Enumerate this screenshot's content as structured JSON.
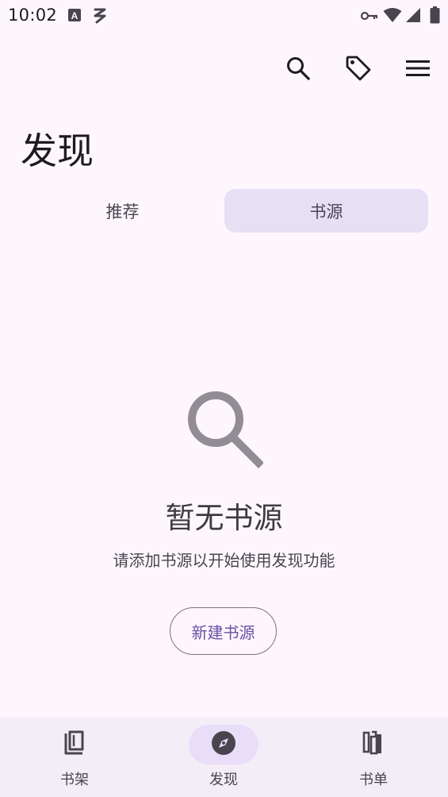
{
  "status_bar": {
    "time": "10:02",
    "icons": [
      "a-notification-icon",
      "signal-broadcast-icon",
      "vpn-key-icon",
      "wifi-icon",
      "cellular-signal-icon",
      "battery-icon"
    ]
  },
  "top_actions": {
    "icons": [
      "search-icon",
      "tag-icon",
      "menu-icon"
    ]
  },
  "page": {
    "title": "发现"
  },
  "tabs": [
    {
      "label": "推荐",
      "active": false
    },
    {
      "label": "书源",
      "active": true
    }
  ],
  "empty_state": {
    "icon": "search-icon",
    "title": "暂无书源",
    "subtitle": "请添加书源以开始使用发现功能",
    "button_label": "新建书源"
  },
  "bottom_nav": {
    "items": [
      {
        "label": "书架",
        "icon": "book-icon",
        "active": false
      },
      {
        "label": "发现",
        "icon": "compass-icon",
        "active": true
      },
      {
        "label": "书单",
        "icon": "booklist-icon",
        "active": false
      }
    ]
  },
  "colors": {
    "background": "#fdf7fd",
    "active_tab": "#e6e0f5",
    "accent": "#6750a4",
    "nav_background": "#f3edf7",
    "nav_active_pill": "#e8def8"
  }
}
